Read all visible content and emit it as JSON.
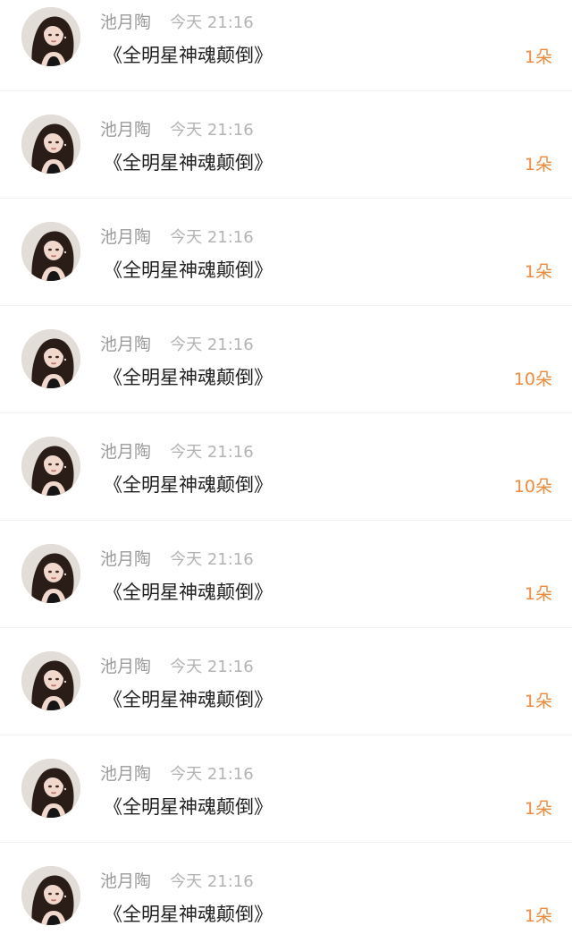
{
  "gift_list": [
    {
      "user_name": "池月陶",
      "time": "今天 21:16",
      "gift_name": "《全明星神魂颠倒》",
      "count": "1朵"
    },
    {
      "user_name": "池月陶",
      "time": "今天 21:16",
      "gift_name": "《全明星神魂颠倒》",
      "count": "1朵"
    },
    {
      "user_name": "池月陶",
      "time": "今天 21:16",
      "gift_name": "《全明星神魂颠倒》",
      "count": "1朵"
    },
    {
      "user_name": "池月陶",
      "time": "今天 21:16",
      "gift_name": "《全明星神魂颠倒》",
      "count": "10朵"
    },
    {
      "user_name": "池月陶",
      "time": "今天 21:16",
      "gift_name": "《全明星神魂颠倒》",
      "count": "10朵"
    },
    {
      "user_name": "池月陶",
      "time": "今天 21:16",
      "gift_name": "《全明星神魂颠倒》",
      "count": "1朵"
    },
    {
      "user_name": "池月陶",
      "time": "今天 21:16",
      "gift_name": "《全明星神魂颠倒》",
      "count": "1朵"
    },
    {
      "user_name": "池月陶",
      "time": "今天 21:16",
      "gift_name": "《全明星神魂颠倒》",
      "count": "1朵"
    },
    {
      "user_name": "池月陶",
      "time": "今天 21:16",
      "gift_name": "《全明星神魂颠倒》",
      "count": "1朵"
    }
  ],
  "colors": {
    "name": "#9a9a9a",
    "time": "#b3b3b3",
    "gift_text": "#1f1f1f",
    "count_accent": "#f08a3c",
    "divider": "#f1f1f1"
  },
  "icons": {
    "avatar": "user-avatar-photo"
  }
}
